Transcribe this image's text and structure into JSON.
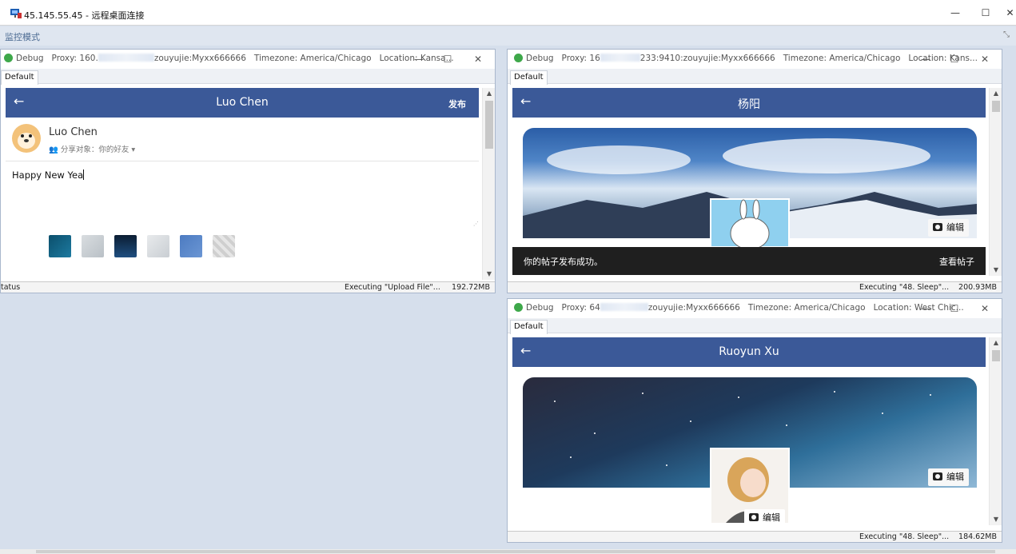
{
  "rdp": {
    "title": "45.145.55.45 - 远程桌面连接",
    "min": "—",
    "max": "☐",
    "close": "✕"
  },
  "monitor": {
    "label": "监控模式",
    "expand": "⤡"
  },
  "windows": [
    {
      "debug": "Debug",
      "proxy_label": "Proxy: 160.",
      "proxy_tail": "zouyujie:Myxx666666",
      "timezone": "Timezone: America/Chicago",
      "location": "Location: Kansa...",
      "tab": "Default",
      "header_name": "Luo Chen",
      "header_action": "发布",
      "back": "←",
      "post": {
        "author": "Luo Chen",
        "share_label": "分享对象：你的好友 ▾",
        "text": "Happy New Yea"
      },
      "status": {
        "left": "tatus",
        "msg": "Executing \"Upload File\"...",
        "mem": "192.72MB"
      }
    },
    {
      "debug": "Debug",
      "proxy_label": "Proxy: 16",
      "proxy_tail": "233:9410:zouyujie:Myxx666666",
      "timezone": "Timezone: America/Chicago",
      "location": "Location: Kans...",
      "tab": "Default",
      "header_name": "杨阳",
      "back": "←",
      "edit": "编辑",
      "toast_msg": "你的帖子发布成功。",
      "toast_action": "查看帖子",
      "status": {
        "msg": "Executing \"48. Sleep\"...",
        "mem": "200.93MB"
      }
    },
    {
      "debug": "Debug",
      "proxy_label": "Proxy: 64",
      "proxy_tail": "zouyujie:Myxx666666",
      "timezone": "Timezone: America/Chicago",
      "location": "Location: West Chic...",
      "tab": "Default",
      "header_name": "Ruoyun Xu",
      "back": "←",
      "edit": "编辑",
      "edit2": "编辑",
      "status": {
        "msg": "Executing \"48. Sleep\"...",
        "mem": "184.62MB"
      }
    }
  ],
  "colors": {
    "fb_blue": "#3b5998",
    "debug_green": "#3ea84a",
    "desktop": "#d6dfec"
  }
}
